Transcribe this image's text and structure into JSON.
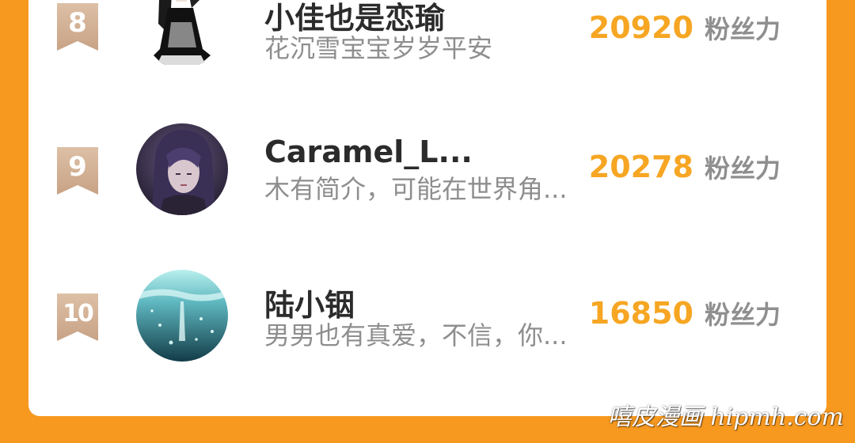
{
  "ranking": {
    "entries": [
      {
        "rank": "8",
        "name": "小佳也是恋瑜",
        "bio": "花沉雪宝宝岁岁平安",
        "score": "20920",
        "unit": "粉丝力",
        "avatar": "avatar-girl-dress"
      },
      {
        "rank": "9",
        "name": "Caramel_L...",
        "bio": "木有简介，可能在世界角...",
        "score": "20278",
        "unit": "粉丝力",
        "avatar": "avatar-purple-hair"
      },
      {
        "rank": "10",
        "name": "陆小铟",
        "bio": "男男也有真爱，不信，你...",
        "score": "16850",
        "unit": "粉丝力",
        "avatar": "avatar-underwater"
      }
    ]
  },
  "watermark": "嘻皮漫画 hipmh.com",
  "colors": {
    "background": "#f7981f",
    "score": "#f6a623",
    "badge": "#c8a285"
  }
}
